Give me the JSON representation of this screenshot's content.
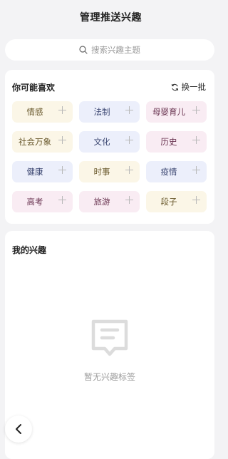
{
  "header": {
    "title": "管理推送兴趣"
  },
  "search": {
    "placeholder": "搜索兴趣主题",
    "icon": "search-icon"
  },
  "suggest": {
    "title": "你可能喜欢",
    "refresh_label": "换一批",
    "tags": [
      {
        "label": "情感",
        "color": "yellow"
      },
      {
        "label": "法制",
        "color": "blue"
      },
      {
        "label": "母婴育儿",
        "color": "pink"
      },
      {
        "label": "社会万象",
        "color": "yellow"
      },
      {
        "label": "文化",
        "color": "blue"
      },
      {
        "label": "历史",
        "color": "pink"
      },
      {
        "label": "健康",
        "color": "blue"
      },
      {
        "label": "时事",
        "color": "yellow"
      },
      {
        "label": "疫情",
        "color": "blue"
      },
      {
        "label": "高考",
        "color": "pink"
      },
      {
        "label": "旅游",
        "color": "pink"
      },
      {
        "label": "段子",
        "color": "yellow"
      }
    ]
  },
  "mine": {
    "title": "我的兴趣",
    "empty_text": "暂无兴趣标签"
  },
  "colors": {
    "yellow": "#fbf6e7",
    "blue": "#eceffb",
    "pink": "#f9ecf3"
  }
}
